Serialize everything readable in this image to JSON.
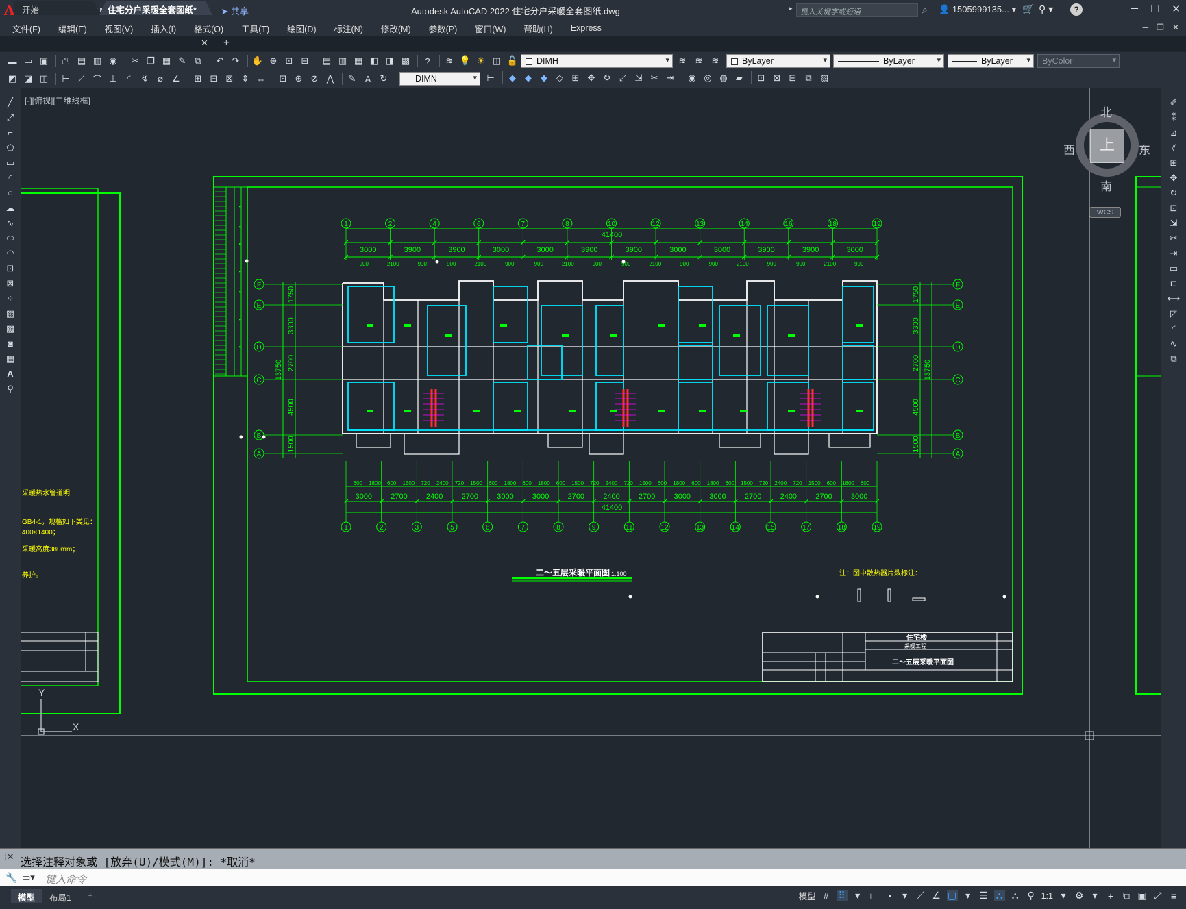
{
  "app": {
    "title": "Autodesk AutoCAD 2022    住宅分户采暖全套图纸.dwg",
    "share_label": "共享",
    "search_placeholder": "键入关键字或短语",
    "user": "1505999135...",
    "accent": "#00ff00"
  },
  "menu": [
    "文件(F)",
    "编辑(E)",
    "视图(V)",
    "插入(I)",
    "格式(O)",
    "工具(T)",
    "绘图(D)",
    "标注(N)",
    "修改(M)",
    "参数(P)",
    "窗口(W)",
    "帮助(H)",
    "Express"
  ],
  "tabs": {
    "start": "开始",
    "doc": "住宅分户采暖全套图纸*"
  },
  "toolbar": {
    "layer": "DIMH",
    "color": "ByLayer",
    "linetype": "ByLayer",
    "lineweight": "ByLayer",
    "plotstyle": "ByColor",
    "dimstyle": "DIMN"
  },
  "viewport": {
    "label": "[-][俯视][二维线框]"
  },
  "viewcube": {
    "n": "北",
    "s": "南",
    "e": "东",
    "w": "西",
    "face": "上",
    "wcs": "WCS"
  },
  "drawing": {
    "top_axes": [
      "1",
      "2",
      "4",
      "6",
      "7",
      "8",
      "10",
      "12",
      "13",
      "14",
      "16",
      "18",
      "19"
    ],
    "top_dims": [
      "3000",
      "3900",
      "3900",
      "3000",
      "3000",
      "3900",
      "3900",
      "3000",
      "3000",
      "3900",
      "3900",
      "3000"
    ],
    "top_sub_dims": [
      "900",
      "2100",
      "900",
      "900",
      "2100",
      "900",
      "900",
      "2100",
      "900",
      "900",
      "2100",
      "900",
      "900",
      "2100",
      "900",
      "900",
      "2100",
      "900"
    ],
    "total_dim": "41400",
    "bottom_axes": [
      "1",
      "2",
      "3",
      "5",
      "6",
      "7",
      "8",
      "9",
      "11",
      "12",
      "13",
      "14",
      "15",
      "17",
      "18",
      "19"
    ],
    "bottom_dims": [
      "3000",
      "2700",
      "2400",
      "2700",
      "3000",
      "3000",
      "2700",
      "2400",
      "2700",
      "3000",
      "3000",
      "2700",
      "2400",
      "2700",
      "3000"
    ],
    "bottom_sub_dims": [
      "600",
      "1800",
      "600",
      "1500",
      "720",
      "2400",
      "720",
      "1500",
      "600",
      "1800",
      "600",
      "1800",
      "600",
      "1500",
      "720",
      "2400",
      "720",
      "1500",
      "600",
      "1800",
      "600",
      "1800",
      "600",
      "1500",
      "720",
      "2400",
      "720",
      "1500",
      "600",
      "1800",
      "600"
    ],
    "side_axes": [
      "F",
      "E",
      "D",
      "C",
      "B",
      "A"
    ],
    "side_dims": [
      "1750",
      "3300",
      "2700",
      "4500",
      "1500"
    ],
    "side_total": "13750",
    "plan_title": "二～五层采暖平面图",
    "plan_scale": "1:100",
    "note": "注：图中散热器片数标注：",
    "title_block": {
      "project": "住宅楼",
      "discipline": "采暖工程",
      "sheet": "二～五层采暖平面图"
    },
    "left_notes": [
      "采暖热水管道明",
      "GB4-1，规格如下类见：",
      "400×1400；",
      "采暖高度380mm；",
      "养护。"
    ]
  },
  "command": {
    "history": "选择注释对象或 [放弃(U)/模式(M)]: *取消*",
    "placeholder": "键入命令"
  },
  "status": {
    "model_tab": "模型",
    "layout_tab": "布局1",
    "model_label": "模型",
    "scale": "1:1"
  }
}
